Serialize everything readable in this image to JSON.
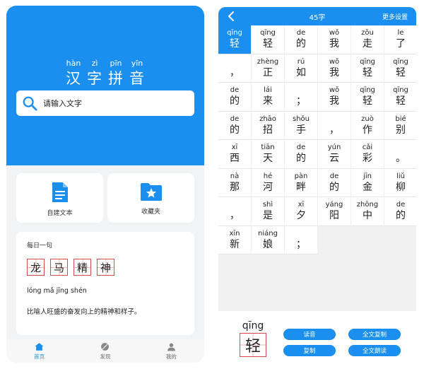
{
  "home": {
    "title_chars": [
      {
        "pinyin": "hàn",
        "hanzi": "汉"
      },
      {
        "pinyin": "zì",
        "hanzi": "字"
      },
      {
        "pinyin": "pīn",
        "hanzi": "拼"
      },
      {
        "pinyin": "yīn",
        "hanzi": "音"
      }
    ],
    "search_placeholder": "请输入文字",
    "feature_new_text": "自建文本",
    "feature_favorites": "收藏夹",
    "daily": {
      "heading": "每日一句",
      "chars": [
        "龙",
        "马",
        "精",
        "神"
      ],
      "pinyin": "lóng mǎ jīng shén",
      "meaning": "比喻人旺盛的奋发向上的精神和样子。"
    },
    "tabs": [
      {
        "label": "首页",
        "icon": "home-icon",
        "active": true
      },
      {
        "label": "发现",
        "icon": "discover-icon",
        "active": false
      },
      {
        "label": "我的",
        "icon": "profile-icon",
        "active": false
      }
    ]
  },
  "detail": {
    "char_count": "45字",
    "more_settings": "更多设置",
    "cells": [
      {
        "py": "qīng",
        "hz": "轻",
        "sel": true
      },
      {
        "py": "qīng",
        "hz": "轻"
      },
      {
        "py": "de",
        "hz": "的"
      },
      {
        "py": "wǒ",
        "hz": "我"
      },
      {
        "py": "zǒu",
        "hz": "走"
      },
      {
        "py": "le",
        "hz": "了"
      },
      {
        "py": "",
        "hz": "，"
      },
      {
        "py": "zhèng",
        "hz": "正"
      },
      {
        "py": "rú",
        "hz": "如"
      },
      {
        "py": "wǒ",
        "hz": "我"
      },
      {
        "py": "qīng",
        "hz": "轻"
      },
      {
        "py": "qīng",
        "hz": "轻"
      },
      {
        "py": "de",
        "hz": "的"
      },
      {
        "py": "lái",
        "hz": "来"
      },
      {
        "py": "",
        "hz": "；"
      },
      {
        "py": "wǒ",
        "hz": "我"
      },
      {
        "py": "qīng",
        "hz": "轻"
      },
      {
        "py": "qīng",
        "hz": "轻"
      },
      {
        "py": "de",
        "hz": "的"
      },
      {
        "py": "zhāo",
        "hz": "招"
      },
      {
        "py": "shǒu",
        "hz": "手"
      },
      {
        "py": "",
        "hz": "，"
      },
      {
        "py": "zuò",
        "hz": "作"
      },
      {
        "py": "bié",
        "hz": "别"
      },
      {
        "py": "xī",
        "hz": "西"
      },
      {
        "py": "tiān",
        "hz": "天"
      },
      {
        "py": "de",
        "hz": "的"
      },
      {
        "py": "yún",
        "hz": "云"
      },
      {
        "py": "cǎi",
        "hz": "彩"
      },
      {
        "py": "",
        "hz": "。"
      },
      {
        "py": "nà",
        "hz": "那"
      },
      {
        "py": "hé",
        "hz": "河"
      },
      {
        "py": "pàn",
        "hz": "畔"
      },
      {
        "py": "de",
        "hz": "的"
      },
      {
        "py": "jīn",
        "hz": "金"
      },
      {
        "py": "liǔ",
        "hz": "柳"
      },
      {
        "py": "",
        "hz": "，"
      },
      {
        "py": "shì",
        "hz": "是"
      },
      {
        "py": "xī",
        "hz": "夕"
      },
      {
        "py": "yáng",
        "hz": "阳"
      },
      {
        "py": "zhōng",
        "hz": "中"
      },
      {
        "py": "de",
        "hz": "的"
      },
      {
        "py": "xīn",
        "hz": "新"
      },
      {
        "py": "niáng",
        "hz": "娘"
      },
      {
        "py": "",
        "hz": "；"
      }
    ],
    "selected": {
      "py": "qīng",
      "hz": "轻"
    },
    "buttons": {
      "read": "读音",
      "copy": "复制",
      "copy_all": "全文复制",
      "read_all": "全文朗读"
    }
  }
}
